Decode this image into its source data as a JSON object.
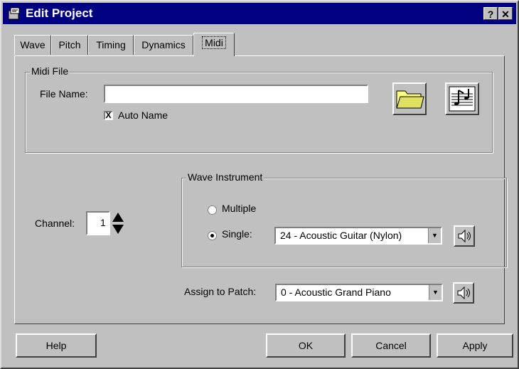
{
  "window": {
    "title": "Edit Project",
    "help_btn": "?",
    "close_btn": "✕"
  },
  "tabs": [
    "Wave",
    "Pitch",
    "Timing",
    "Dynamics",
    "Midi"
  ],
  "midi_file": {
    "group_label": "Midi File",
    "file_name_label": "File Name:",
    "file_name_value": "",
    "auto_name_label": "Auto Name",
    "auto_name_checked": "X"
  },
  "channel": {
    "label": "Channel:",
    "value": "1"
  },
  "wave_instrument": {
    "group_label": "Wave Instrument",
    "multiple_label": "Multiple",
    "single_label": "Single:",
    "instrument_value": "24 - Acoustic Guitar (Nylon)"
  },
  "assign": {
    "label": "Assign to Patch:",
    "value": "0 - Acoustic Grand Piano"
  },
  "buttons": {
    "help": "Help",
    "ok": "OK",
    "cancel": "Cancel",
    "apply": "Apply"
  }
}
